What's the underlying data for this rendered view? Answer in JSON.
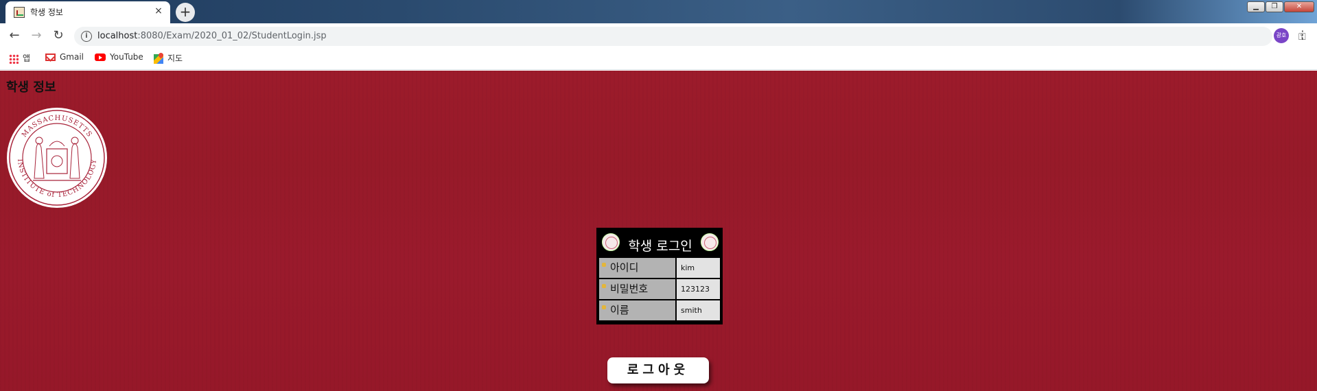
{
  "browser": {
    "tab_title": "학생 정보",
    "tab_close": "×",
    "new_tab": "+",
    "url_host": "localhost",
    "url_path": ":8080/Exam/2020_01_02/StudentLogin.jsp",
    "profile_initials": "광호",
    "bookmarks": [
      {
        "label": "앱",
        "icon": "apps-icon"
      },
      {
        "label": "Gmail",
        "icon": "gmail-icon"
      },
      {
        "label": "YouTube",
        "icon": "youtube-icon"
      },
      {
        "label": "지도",
        "icon": "maps-icon"
      }
    ]
  },
  "page": {
    "title": "학생 정보",
    "seal": {
      "top_text": "MASSACHUSETTS",
      "bottom_text": "INSTITUTE of TECHNOLOGY"
    },
    "login": {
      "title": "학생 로그인",
      "rows": [
        {
          "label": "아이디",
          "value": "kim"
        },
        {
          "label": "비밀번호",
          "value": "123123"
        },
        {
          "label": "이름",
          "value": "smith"
        }
      ]
    },
    "logout_label": "로그아웃"
  },
  "colors": {
    "background": "#9a1a2b",
    "label_cell": "#b3b3b3",
    "value_cell": "#e3e3e3",
    "bullet": "#e4b63a"
  }
}
